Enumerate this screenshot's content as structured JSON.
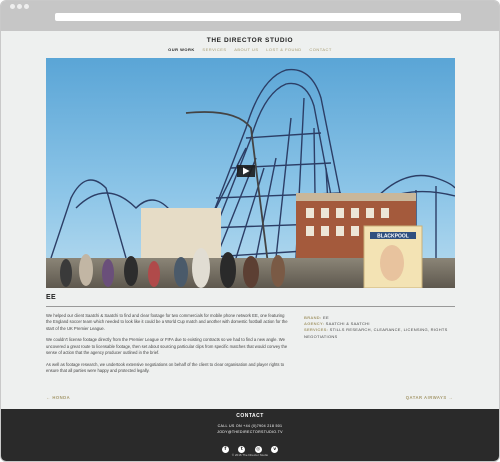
{
  "site": {
    "title": "THE DIRECTOR STUDIO",
    "nav": [
      {
        "label": "OUR WORK",
        "active": true
      },
      {
        "label": "SERVICES",
        "active": false
      },
      {
        "label": "ABOUT US",
        "active": false
      },
      {
        "label": "LOST & FOUND",
        "active": false
      },
      {
        "label": "CONTACT",
        "active": false
      }
    ]
  },
  "hero": {
    "sign_text": "BLACKPOOL",
    "play_icon": "play-icon"
  },
  "project": {
    "title": "EE",
    "paragraphs": [
      "We helped our client Saatchi & Saatchi to find and clear footage for two commercials for mobile phone network EE, one featuring the England soccer team which needed to look like it could be a World Cup match and another with domestic football action for the start of the UK Premier League.",
      "We couldn't license footage directly from the Premier League or FIFA due to existing contracts so we had to find a new angle.  We uncovered a great route to licensable footage, then set about sourcing particular clips from specific matches that would convey the sense of action that the agency producer outlined in the brief.",
      "As well as footage research, we undertook extensive negotiations on behalf of the client to clear organisation and player rights to ensure that all parties were happy and protected legally."
    ],
    "meta": {
      "brand_label": "BRAND:",
      "brand_value": "EE",
      "agency_label": "AGENCY:",
      "agency_value": "SAATCHI & SAATCHI",
      "services_label": "SERVICES:",
      "services_value": "STILLS RESEARCH, CLEARANCE, LICENSING, RIGHTS NEGOTIATIONS"
    },
    "prev": "← HONDA",
    "next": "QATAR AIRWAYS →"
  },
  "footer": {
    "title": "CONTACT",
    "phone": "CALL US ON +44 (0)7904 218 501",
    "email": "JODY@THEDIRECTORSTUDIO.TV",
    "socials": [
      {
        "icon": "facebook-icon",
        "glyph": "f"
      },
      {
        "icon": "twitter-icon",
        "glyph": "t"
      },
      {
        "icon": "instagram-icon",
        "glyph": "◎"
      },
      {
        "icon": "vimeo-icon",
        "glyph": "v"
      }
    ],
    "copyright": "© 2016 The Director Studio"
  },
  "colors": {
    "accent": "#a69a6e",
    "footer_bg": "#2a2a2a",
    "page_bg": "#eef0ef"
  }
}
